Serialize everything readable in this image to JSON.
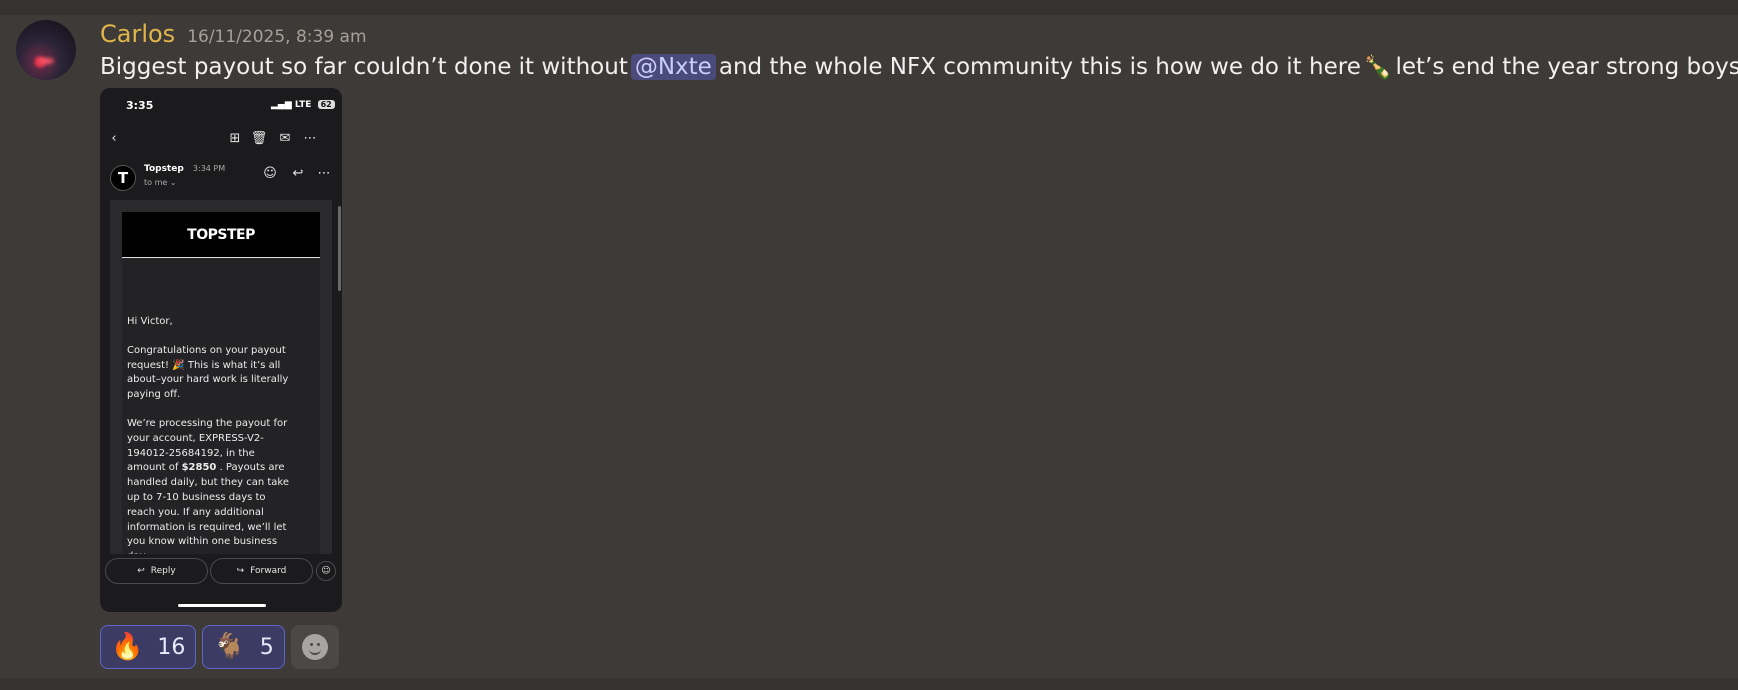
{
  "message": {
    "username": "Carlos",
    "timestamp": "16/11/2025, 8:39 am",
    "text_before": "Biggest payout so far couldn’t done it without",
    "mention": "@Nxte",
    "text_middle": "and the whole NFX community this is how we do it here",
    "emoji_celebrate": "🍾",
    "text_after": "let’s end the year strong boys",
    "emoji_flex": "💪🏼"
  },
  "phone": {
    "status_time": "3:35",
    "status_signal": "LTE",
    "battery": "62",
    "sender": "Topstep",
    "sender_time": "3:34 PM",
    "to_me": "to me",
    "banner": "TOPSTEP",
    "greeting": "Hi Victor,",
    "para1": "Congratulations on your payout request! 🎉 This is what it’s all about–your hard work is literally paying off.",
    "para2_a": "We’re processing the payout for your account, EXPRESS-V2-194012-25684192, in the amount of",
    "para2_amount": "$2850",
    "para2_b": ". Payouts are handled daily, but they can take up to 7-10 business days to reach you. If any additional information is required, we’ll let you know within one business day.",
    "reply_label": "Reply",
    "forward_label": "Forward"
  },
  "reactions": [
    {
      "emoji": "🔥",
      "count": "16"
    },
    {
      "emoji": "🐐",
      "count": "5"
    }
  ],
  "colors": {
    "background": "#3e3a37",
    "username": "#e0b54b",
    "mention_bg": "#4a4b7a",
    "reaction_border": "#5e64c8"
  }
}
